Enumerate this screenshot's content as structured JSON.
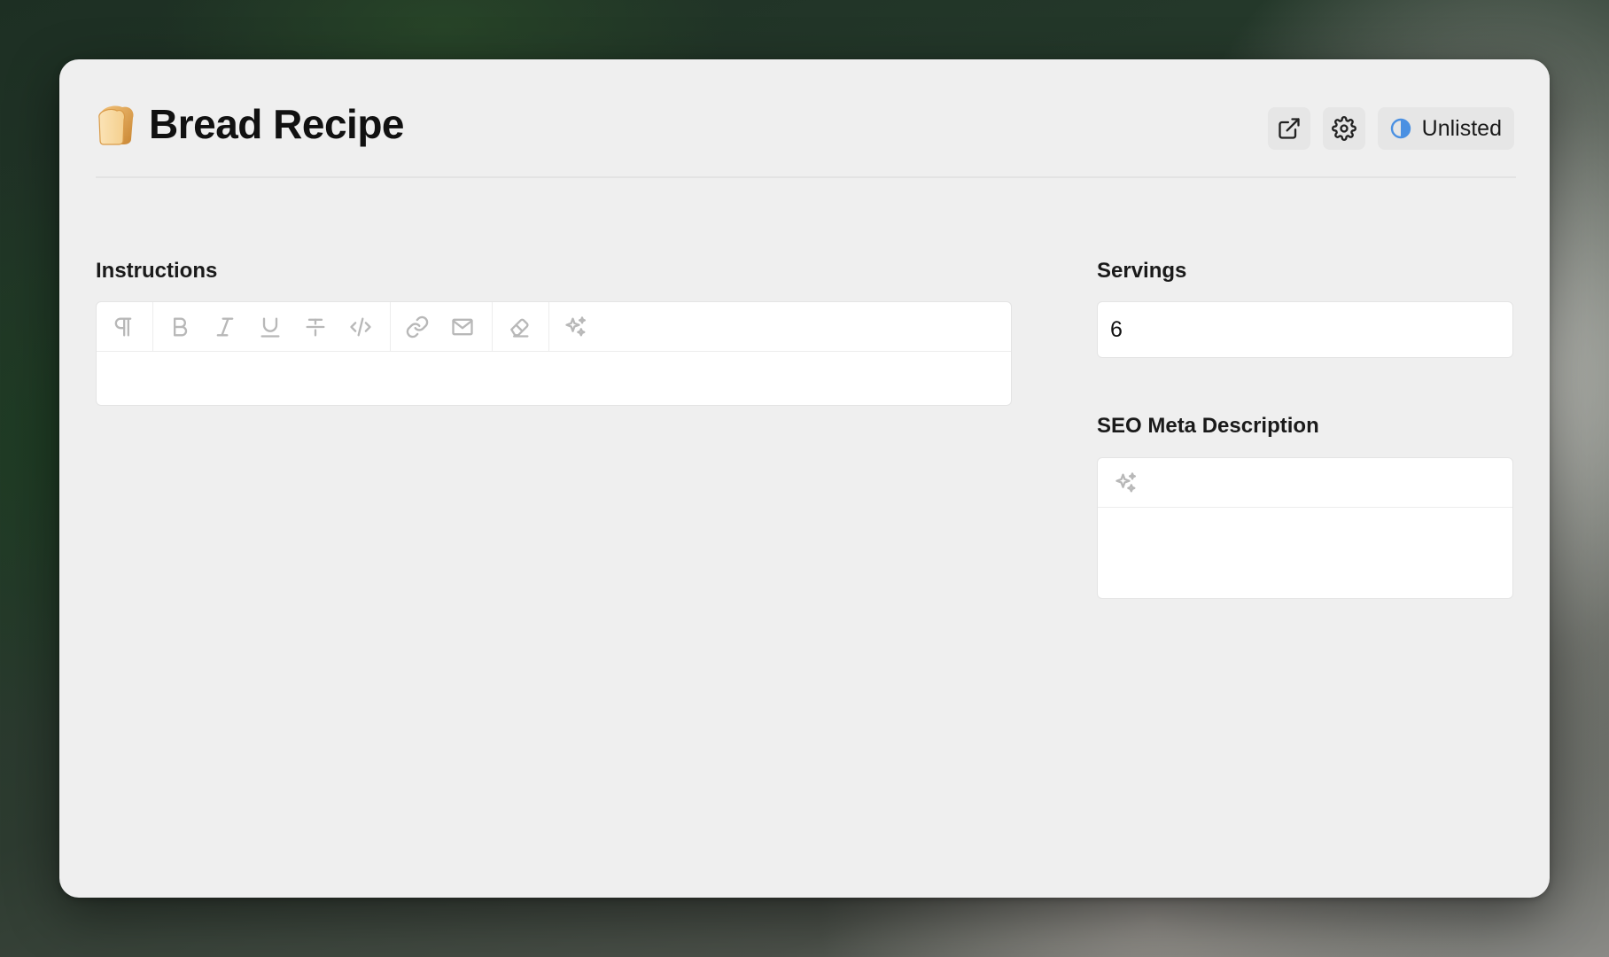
{
  "window": {
    "title": "Bread Recipe",
    "title_emoji": "bread-icon"
  },
  "header_actions": {
    "open_external_icon": "external-link-icon",
    "settings_icon": "gear-icon",
    "status": {
      "label": "Unlisted",
      "icon": "half-circle-icon",
      "icon_color": "#4a90e2"
    }
  },
  "instructions": {
    "label": "Instructions",
    "value": "",
    "toolbar": [
      {
        "name": "paragraph",
        "icon": "pilcrow-icon"
      },
      {
        "name": "bold",
        "icon": "bold-icon"
      },
      {
        "name": "italic",
        "icon": "italic-icon"
      },
      {
        "name": "underline",
        "icon": "underline-icon"
      },
      {
        "name": "strikethrough",
        "icon": "strikethrough-icon"
      },
      {
        "name": "code",
        "icon": "code-icon"
      },
      {
        "name": "link",
        "icon": "link-icon"
      },
      {
        "name": "email",
        "icon": "envelope-icon"
      },
      {
        "name": "clear-formatting",
        "icon": "eraser-icon"
      },
      {
        "name": "ai-assist",
        "icon": "sparkles-icon"
      }
    ]
  },
  "servings": {
    "label": "Servings",
    "value": "6"
  },
  "seo": {
    "label": "SEO Meta Description",
    "value": "",
    "toolbar_icon": "sparkles-icon"
  },
  "colors": {
    "window_bg": "#efefef",
    "field_bg": "#ffffff",
    "icon_muted": "#b8b8b8",
    "accent": "#4a90e2"
  }
}
